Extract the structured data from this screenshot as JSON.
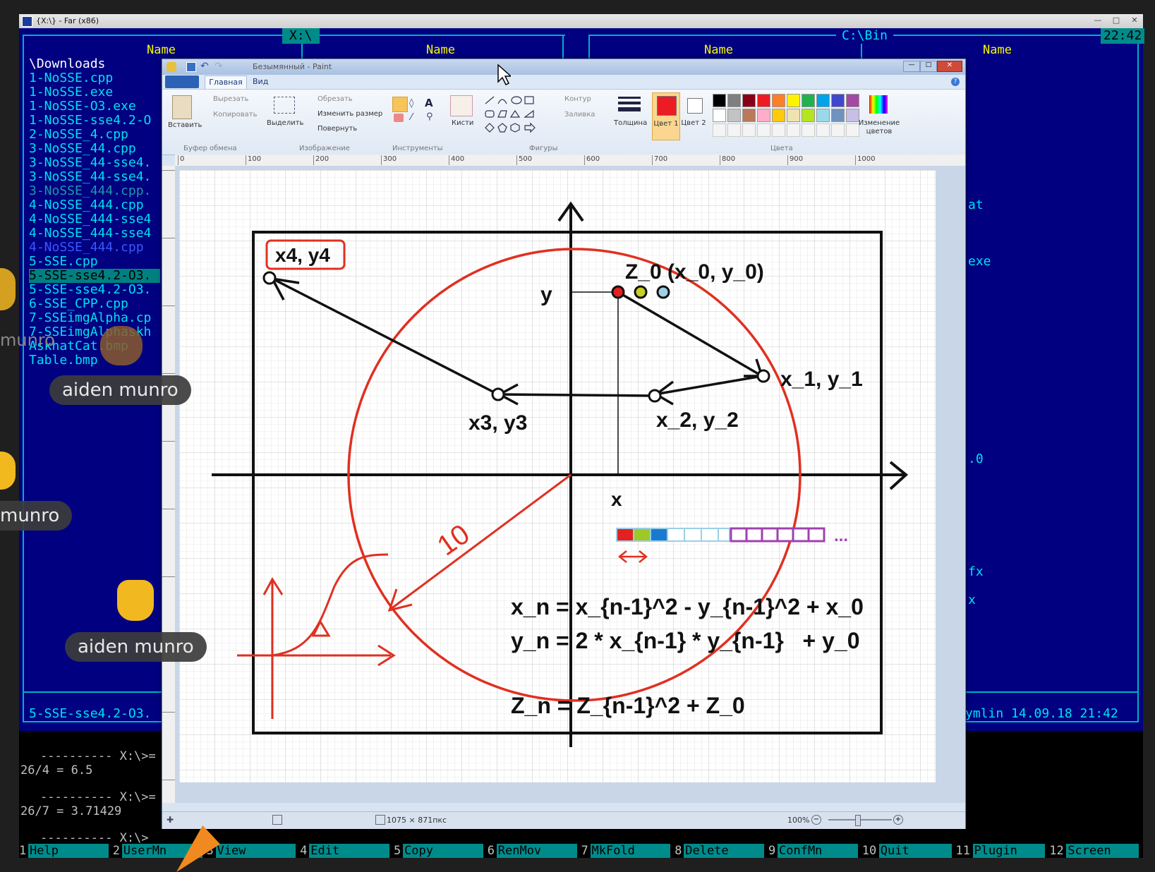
{
  "far": {
    "title": "{X:\\} - Far (x86)",
    "clock": "22:42",
    "left_path": "X:\\",
    "right_path": "C:\\Bin",
    "column_header": "Name",
    "folder": "\\Downloads",
    "files": [
      "1-NoSSE.cpp",
      "1-NoSSE.exe",
      "1-NoSSE-O3.exe",
      "1-NoSSE-sse4.2-O",
      "2-NoSSE_4.cpp",
      "3-NoSSE_44.cpp",
      "3-NoSSE_44-sse4.",
      "3-NoSSE_44-sse4.",
      "3-NoSSE_444.cpp.",
      "4-NoSSE_444.cpp",
      "4-NoSSE_444-sse4",
      "4-NoSSE_444-sse4",
      "4-NoSSE_444.cpp",
      "5-SSE.cpp",
      "5-SSE-sse4.2-O3.",
      "5-SSE-sse4.2-O3.",
      "6-SSE_CPP.cpp",
      "7-SSEimgAlpha.cp",
      "7-SSEimgAlphaskh",
      "AskhatCat.bmp",
      "Table.bmp"
    ],
    "status_left": "5-SSE-sse4.2-O3.",
    "status_right": "ymlin 14.09.18 21:42",
    "right_fragments": [
      "at",
      "exe",
      ".0",
      "fx",
      "x"
    ],
    "cmd_lines": [
      "---------- X:\\>=",
      "26/4 = 6.5",
      "---------- X:\\>=",
      "26/7 = 3.71429",
      "---------- X:\\>"
    ],
    "keys": [
      {
        "n": "1",
        "l": "Help"
      },
      {
        "n": "2",
        "l": "UserMn"
      },
      {
        "n": "3",
        "l": "View"
      },
      {
        "n": "4",
        "l": "Edit"
      },
      {
        "n": "5",
        "l": "Copy"
      },
      {
        "n": "6",
        "l": "RenMov"
      },
      {
        "n": "7",
        "l": "MkFold"
      },
      {
        "n": "8",
        "l": "Delete"
      },
      {
        "n": "9",
        "l": "ConfMn"
      },
      {
        "n": "10",
        "l": "Quit"
      },
      {
        "n": "11",
        "l": "Plugin"
      },
      {
        "n": "12",
        "l": "Screen"
      }
    ]
  },
  "paint": {
    "title": "Безымянный - Paint",
    "tabs": [
      "Главная",
      "Вид"
    ],
    "clipboard": {
      "paste": "Вставить",
      "cut": "Вырезать",
      "copy": "Копировать",
      "group": "Буфер обмена"
    },
    "image": {
      "select": "Выделить",
      "crop": "Обрезать",
      "resize": "Изменить размер",
      "rotate": "Повернуть",
      "group": "Изображение"
    },
    "tools_group": "Инструменты",
    "brushes": "Кисти",
    "shapes": {
      "outline": "Контур",
      "fill": "Заливка",
      "group": "Фигуры"
    },
    "thickness": "Толщина",
    "color1": "Цвет 1",
    "color2": "Цвет 2",
    "colors_group": "Цвета",
    "edit_colors": "Изменение цветов",
    "palette_row1": [
      "#000000",
      "#7f7f7f",
      "#880015",
      "#ed1c24",
      "#ff7f27",
      "#fff200",
      "#22b14c",
      "#00a2e8",
      "#3f48cc",
      "#a349a4"
    ],
    "palette_row2": [
      "#ffffff",
      "#c3c3c3",
      "#b97a57",
      "#ffaec9",
      "#ffc90e",
      "#efe4b0",
      "#b5e61d",
      "#99d9ea",
      "#7092be",
      "#c8bfe7"
    ],
    "ruler_marks": [
      "0",
      "100",
      "200",
      "300",
      "400",
      "500",
      "600",
      "700",
      "800",
      "900",
      "1000"
    ],
    "canvas_size": "1075 × 871пкс",
    "zoom": "100%"
  },
  "drawing": {
    "label_x4y4": "x4, y4",
    "label_z0": "Z_0 (x_0, y_0)",
    "label_y": "y",
    "label_x": "x",
    "label_x1y1": "x_1, y_1",
    "label_x2y2": "x_2, y_2",
    "label_x3y3": "x3, y3",
    "label_10": "10",
    "dots": "...",
    "formula1": "x_n = x_{n-1}^2 - y_{n-1}^2 + x_0",
    "formula2": "y_n = 2 * x_{n-1} * y_{n-1}   + y_0",
    "formula3": "Z_n = Z_{n-1}^2 + Z_0"
  },
  "chat": {
    "user": "aiden munro",
    "user_short": "munro",
    "user_cut": "munro"
  }
}
